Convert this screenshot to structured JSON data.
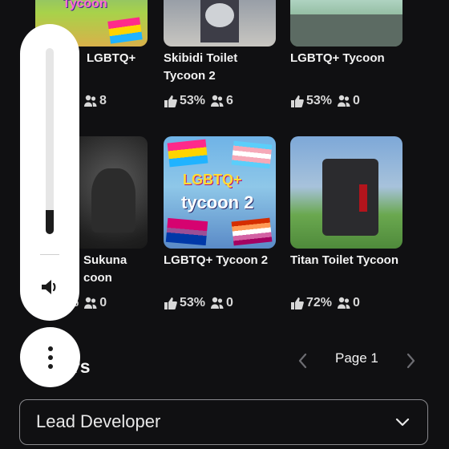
{
  "games": [
    {
      "title_lines": [
        "LGBTQ+",
        ""
      ],
      "rating": "",
      "players": "8",
      "badge": "Tycoon"
    },
    {
      "title_lines": [
        "Skibidi Toilet",
        "Tycoon 2"
      ],
      "rating": "53%",
      "players": "6"
    },
    {
      "title_lines": [
        "LGBTQ+ Tycoon",
        ""
      ],
      "rating": "53%",
      "players": "0"
    },
    {
      "title_lines": [
        "Sukuna",
        "coon"
      ],
      "rating": "%",
      "players": "0"
    },
    {
      "title_lines": [
        "LGBTQ+ Tycoon 2",
        ""
      ],
      "rating": "53%",
      "players": "0",
      "thumb_text_top": "LGBTQ+",
      "thumb_text_bottom": "tycoon 2"
    },
    {
      "title_lines": [
        "Titan Toilet Tycoon",
        ""
      ],
      "rating": "72%",
      "players": "0"
    }
  ],
  "section": {
    "title": "ers"
  },
  "pager": {
    "label": "Page 1"
  },
  "dropdown": {
    "value": "Lead Developer"
  },
  "icons": {
    "like": "thumbs-up-icon",
    "players": "people-icon",
    "volume": "volume-icon",
    "more": "more-vertical-icon",
    "prev": "chevron-left-icon",
    "next": "chevron-right-icon",
    "dropdown": "chevron-down-icon"
  }
}
